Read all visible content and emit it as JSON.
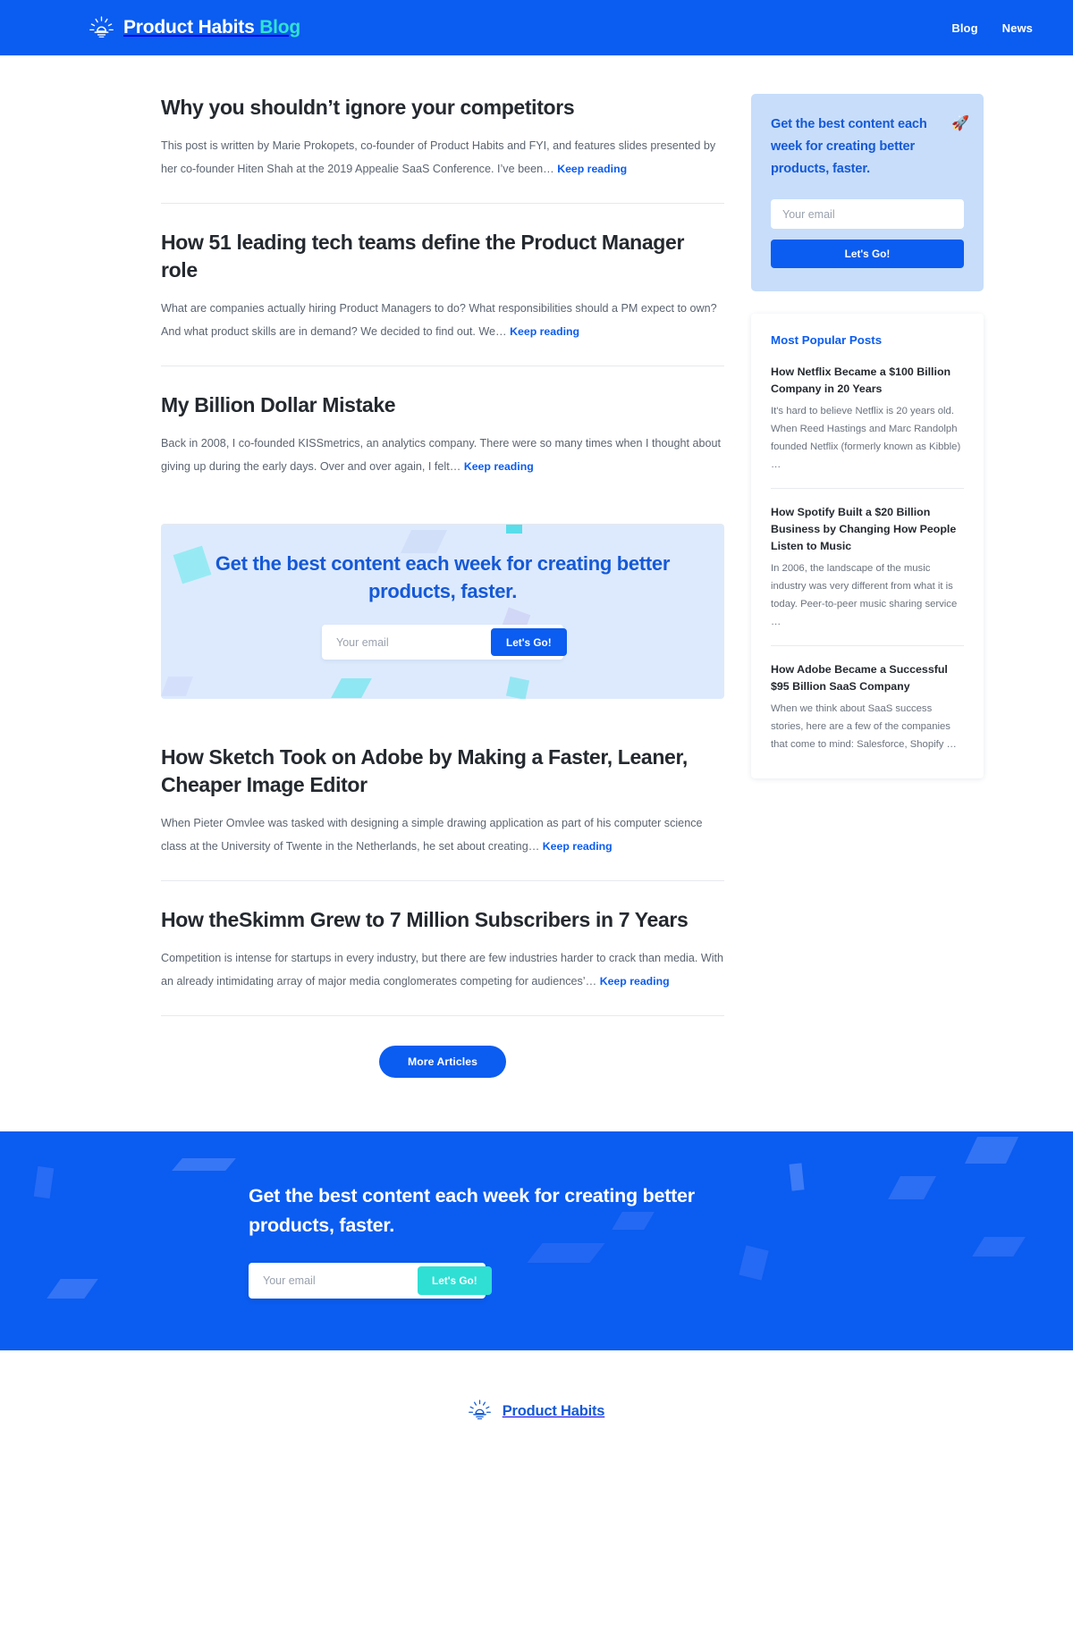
{
  "header": {
    "logo_icon": "sun-lightbulb-icon",
    "brand_name": "Product Habits",
    "brand_suffix": "Blog",
    "nav": [
      {
        "label": "Blog"
      },
      {
        "label": "News"
      }
    ]
  },
  "articles": [
    {
      "title": "Why you shouldn’t ignore your competitors",
      "excerpt": "This post is written by Marie Prokopets, co-founder of Product Habits and FYI, and features slides presented by her co-founder Hiten Shah at the 2019 Appealie SaaS Conference. I’ve been…",
      "link_label": "Keep reading"
    },
    {
      "title": "How 51 leading tech teams define the Product Manager role",
      "excerpt": "What are companies actually hiring Product Managers to do? What responsibilities should a PM expect to own? And what product skills are in demand? We decided to find out. We…",
      "link_label": "Keep reading"
    },
    {
      "title": "My Billion Dollar Mistake",
      "excerpt": "Back in 2008, I co-founded KISSmetrics, an analytics company. There were so many times when I thought about giving up during the early days. Over and over again, I felt…",
      "link_label": "Keep reading"
    },
    {
      "title": "How Sketch Took on Adobe by Making a Faster, Leaner, Cheaper Image Editor",
      "excerpt": "When Pieter Omvlee was tasked with designing a simple drawing application as part of his computer science class at the University of Twente in the Netherlands, he set about creating…",
      "link_label": "Keep reading"
    },
    {
      "title": "How theSkimm Grew to 7 Million Subscribers in 7 Years",
      "excerpt": "Competition is intense for startups in every industry, but there are few industries harder to crack than media. With an already intimidating array of major media conglomerates competing for audiences’…",
      "link_label": "Keep reading"
    }
  ],
  "inline_cta": {
    "title": "Get the best content each week for creating better products, faster.",
    "email_placeholder": "Your email",
    "email_value": "",
    "button_label": "Let's Go!"
  },
  "more_articles_label": "More Articles",
  "sidebar": {
    "cta": {
      "title": "Get the best content each week for creating better products, faster.",
      "emoji": "🚀",
      "emoji_name": "rocket-emoji",
      "email_placeholder": "Your email",
      "email_value": "",
      "button_label": "Let's Go!"
    },
    "popular": {
      "heading": "Most Popular Posts",
      "items": [
        {
          "title": "How Netflix Became a $100 Billion Company in 20 Years",
          "excerpt": "It's hard to believe Netflix is 20 years old. When Reed Hastings and Marc Randolph founded Netflix (formerly known as Kibble) …"
        },
        {
          "title": "How Spotify Built a $20 Billion Business by Changing How People Listen to Music",
          "excerpt": "In 2006, the landscape of the music industry was very different from what it is today. Peer-to-peer music sharing service …"
        },
        {
          "title": "How Adobe Became a Successful $95 Billion SaaS Company",
          "excerpt": "When we think about SaaS success stories, here are a few of the companies that come to mind: Salesforce, Shopify …"
        }
      ]
    }
  },
  "footer_cta": {
    "title": "Get the best content each week for creating better products, faster.",
    "email_placeholder": "Your email",
    "email_value": "",
    "button_label": "Let's Go!"
  },
  "footer": {
    "logo_icon": "sun-lightbulb-icon",
    "brand_name": "Product Habits"
  },
  "colors": {
    "brand_blue": "#0b5cf0",
    "accent_cyan": "#2fe3d0",
    "cta_bg_light": "#ddeafd",
    "sidebar_cta_bg": "#c7ddfa",
    "text_dark": "#24292f",
    "text_muted": "#5b6470"
  }
}
